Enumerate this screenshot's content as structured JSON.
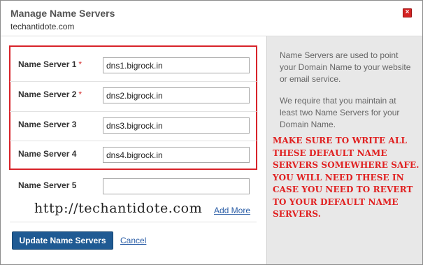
{
  "dialog": {
    "title": "Manage Name Servers",
    "domain": "techantidote.com",
    "close_icon": "close-icon"
  },
  "form": {
    "rows": [
      {
        "label": "Name Server 1",
        "required": "*",
        "value": "dns1.bigrock.in"
      },
      {
        "label": "Name Server 2",
        "required": "*",
        "value": "dns2.bigrock.in"
      },
      {
        "label": "Name Server 3",
        "required": "",
        "value": "dns3.bigrock.in"
      },
      {
        "label": "Name Server 4",
        "required": "",
        "value": "dns4.bigrock.in"
      },
      {
        "label": "Name Server 5",
        "required": "",
        "value": ""
      }
    ],
    "add_more": "Add More",
    "update_label": "Update Name Servers",
    "cancel_label": "Cancel"
  },
  "sidebar": {
    "info1": "Name Servers are used to point your Domain Name to your website or email service.",
    "info2": "We require that you maintain at least two Name Servers for your Domain Name.",
    "warning": "MAKE SURE TO WRITE ALL THESE DEFAULT NAME SERVERS SOMEWHERE SAFE. YOU WILL NEED THESE IN CASE YOU NEED TO REVERT TO YOUR DEFAULT NAME SERVERS."
  },
  "watermark": "http://techantidote.com",
  "colors": {
    "accent": "#1f5a93",
    "link": "#2a5da6",
    "warning": "#e02020",
    "highlight": "#d8232a"
  }
}
